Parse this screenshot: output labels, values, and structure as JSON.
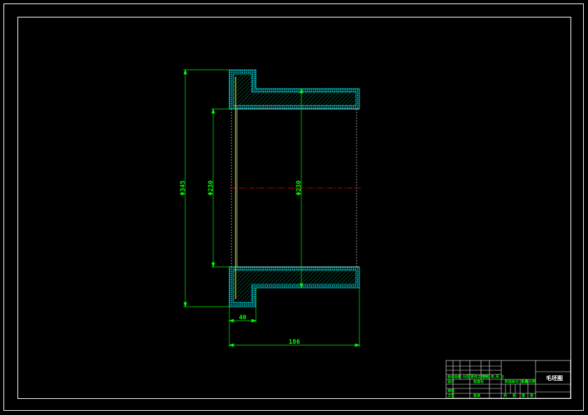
{
  "drawing": {
    "title": "毛坯图",
    "dimensions": {
      "outer_diameter": "Φ345",
      "bore_diameter": "Φ230",
      "inner_diameter": "Φ230",
      "flange_width": "40",
      "total_length": "186"
    }
  },
  "title_block": {
    "row_labels": [
      "标记",
      "处数",
      "分区",
      "更改文件号",
      "签名",
      "年.月.日"
    ],
    "design_label": "设计",
    "standard_label": "标准化",
    "stage_label": "阶段标记",
    "weight_label": "重量",
    "scale_label": "比例",
    "review_label": "审核",
    "process_label": "工艺",
    "approve_label": "批准",
    "sheets": [
      "共",
      "张",
      "第",
      "张"
    ]
  },
  "colors": {
    "background": "#000000",
    "border": "#ffffff",
    "outline": "#00ffff",
    "dimension": "#00ff00",
    "centerline": "#ff0000",
    "hatch": "#00ff00",
    "bore_line": "#ffff00"
  }
}
